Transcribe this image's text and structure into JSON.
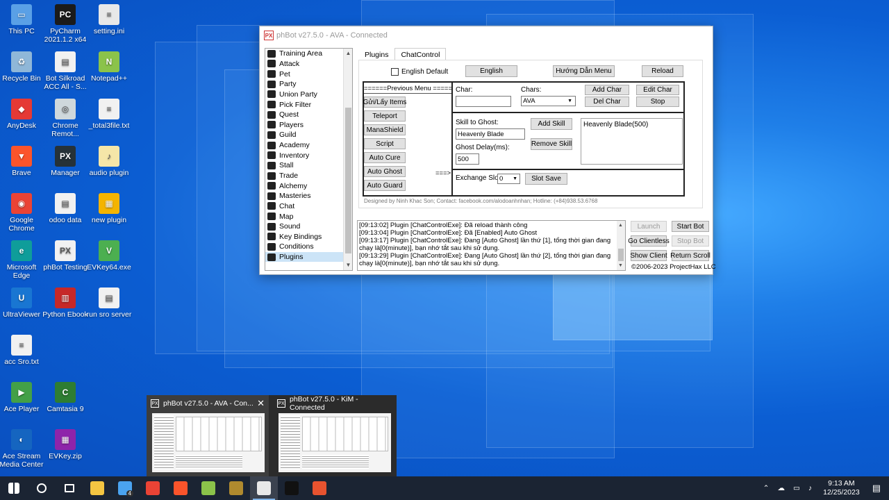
{
  "desktop": {
    "icons": [
      {
        "label": "This PC",
        "color": "#5aa0e6",
        "glyph": "▭"
      },
      {
        "label": "PyCharm 2021.1.2 x64",
        "color": "#1b1b1b",
        "glyph": "PC"
      },
      {
        "label": "setting.ini",
        "color": "#e8e8e8",
        "glyph": "≡"
      },
      {
        "label": "Recycle Bin",
        "color": "#8fb7d8",
        "glyph": "♻"
      },
      {
        "label": "Bot Silkroad ACC All - S...",
        "color": "#f1f1f1",
        "glyph": "▤"
      },
      {
        "label": "Notepad++",
        "color": "#8bc34a",
        "glyph": "N"
      },
      {
        "label": "AnyDesk",
        "color": "#e53935",
        "glyph": "◆"
      },
      {
        "label": "Chrome Remot...",
        "color": "#cfd8dc",
        "glyph": "◎"
      },
      {
        "label": "_total3file.txt",
        "color": "#f1f1f1",
        "glyph": "≡"
      },
      {
        "label": "Brave",
        "color": "#fb542b",
        "glyph": "▼"
      },
      {
        "label": "Manager",
        "color": "#263238",
        "glyph": "PX"
      },
      {
        "label": "audio plugin",
        "color": "#f5e6a8",
        "glyph": "♪"
      },
      {
        "label": "Google Chrome",
        "color": "#ea4335",
        "glyph": "◉"
      },
      {
        "label": "odoo data",
        "color": "#f1f1f1",
        "glyph": "▤"
      },
      {
        "label": "new plugin",
        "color": "#f4b400",
        "glyph": "▦"
      },
      {
        "label": "Microsoft Edge",
        "color": "#0f9d9a",
        "glyph": "e"
      },
      {
        "label": "phBot Testing",
        "color": "#f1f1f1",
        "glyph": "PX"
      },
      {
        "label": "EVKey64.exe",
        "color": "#4caf50",
        "glyph": "V"
      },
      {
        "label": "UltraViewer",
        "color": "#1976d2",
        "glyph": "U"
      },
      {
        "label": "Python Ebook",
        "color": "#c62828",
        "glyph": "▥"
      },
      {
        "label": "run sro server",
        "color": "#f1f1f1",
        "glyph": "▤"
      },
      {
        "label": "acc Sro.txt",
        "color": "#f1f1f1",
        "glyph": "≡"
      },
      {
        "label": "Ace Player",
        "color": "#43a047",
        "glyph": "▶"
      },
      {
        "label": "Camtasia 9",
        "color": "#2e7d32",
        "glyph": "C"
      },
      {
        "label": "Ace Stream Media Center",
        "color": "#1565c0",
        "glyph": "◐"
      },
      {
        "label": "EVKey.zip",
        "color": "#8e24aa",
        "glyph": "▦"
      }
    ]
  },
  "window": {
    "title": "phBot v27.5.0 - AVA - Connected",
    "logo": "PX",
    "nav_items": [
      {
        "label": "Training Area"
      },
      {
        "label": "Attack"
      },
      {
        "label": "Pet"
      },
      {
        "label": "Party"
      },
      {
        "label": "Union Party"
      },
      {
        "label": "Pick Filter"
      },
      {
        "label": "Quest"
      },
      {
        "label": "Players"
      },
      {
        "label": "Guild"
      },
      {
        "label": "Academy"
      },
      {
        "label": "Inventory"
      },
      {
        "label": "Stall"
      },
      {
        "label": "Trade"
      },
      {
        "label": "Alchemy"
      },
      {
        "label": "Masteries"
      },
      {
        "label": "Chat"
      },
      {
        "label": "Map"
      },
      {
        "label": "Sound"
      },
      {
        "label": "Key Bindings"
      },
      {
        "label": "Conditions"
      },
      {
        "label": "Plugins"
      }
    ],
    "selected_nav": "Plugins",
    "tabs": [
      {
        "label": "Plugins"
      },
      {
        "label": "ChatControl"
      }
    ],
    "active_tab": "ChatControl",
    "chatcontrol": {
      "english_default_label": "English Default",
      "english_button": "English",
      "guide_button": "Hướng Dẫn Menu",
      "reload_button": "Reload",
      "previous_menu": "======Previous Menu =====",
      "menu_buttons": [
        "Gửi/Lấy Items",
        "Teleport",
        "ManaShield",
        "Script",
        "Auto Cure",
        "Auto Ghost",
        "Auto Guard"
      ],
      "arrow": "===>",
      "char_label": "Char:",
      "char_value": "",
      "chars_label": "Chars:",
      "chars_selected": "AVA",
      "add_char": "Add Char",
      "edit_char": "Edit Char",
      "del_char": "Del Char",
      "stop": "Stop",
      "skill_label": "Skill to Ghost:",
      "skill_value": "Heavenly Blade",
      "add_skill": "Add Skill",
      "remove_skill": "Remove Skill",
      "delay_label": "Ghost Delay(ms):",
      "delay_value": "500",
      "skill_list": [
        "Heavenly Blade(500)"
      ],
      "exchange_label": "Exchange Slot:",
      "exchange_value": "0",
      "slot_save": "Slot Save",
      "credits": "Designed by Ninh Khac Son; Contact: facebook.com/alodoanhnhan; Hotline: (+84)938.53.6768"
    },
    "log_lines": [
      "[09:13:02] Plugin [ChatControlExe]: Đã reload thành công",
      "[09:13:04] Plugin [ChatControlExe]: Đã [Enabled] Auto Ghost",
      "[09:13:17] Plugin [ChatControlExe]: Đang [Auto Ghost] lần thứ [1], tổng thời gian đang chạy là[0(minute)], bạn nhớ tắt sau khi sử dụng.",
      "[09:13:29] Plugin [ChatControlExe]: Đang [Auto Ghost] lần thứ [2], tổng thời gian đang chạy là[0(minute)], bạn nhớ tắt sau khi sử dụng."
    ],
    "bottom_buttons": {
      "launch": "Launch",
      "start_bot": "Start Bot",
      "go_clientless": "Go Clientless",
      "stop_bot": "Stop Bot",
      "show_client": "Show Client",
      "return_scroll": "Return Scroll"
    },
    "copyright": "©2006-2023 ProjectHax LLC"
  },
  "thumbnails": [
    {
      "title": "phBot v27.5.0 - AVA - Con...",
      "close": "✕"
    },
    {
      "title": "phBot v27.5.0 - KiM - Connected"
    }
  ],
  "taskbar": {
    "items": [
      {
        "name": "start-icon",
        "color": "#ffffff"
      },
      {
        "name": "search-icon",
        "color": "#ffffff"
      },
      {
        "name": "task-view-icon",
        "color": "#ffffff"
      },
      {
        "name": "file-explorer-icon",
        "color": "#f4c542"
      },
      {
        "name": "mail-icon",
        "color": "#4aa3f0",
        "badge": "4"
      },
      {
        "name": "chrome-icon",
        "color": "#ea4335"
      },
      {
        "name": "brave-icon",
        "color": "#fb542b"
      },
      {
        "name": "notepadpp-icon",
        "color": "#8bc34a"
      },
      {
        "name": "game-icon",
        "color": "#b08a2e"
      },
      {
        "name": "phbot-icon",
        "color": "#e8e8e8",
        "active": true
      },
      {
        "name": "phbot-manager-icon",
        "color": "#111111"
      },
      {
        "name": "camtasia-icon",
        "color": "#e8532f"
      }
    ],
    "time": "9:13 AM",
    "date": "12/25/2023"
  }
}
